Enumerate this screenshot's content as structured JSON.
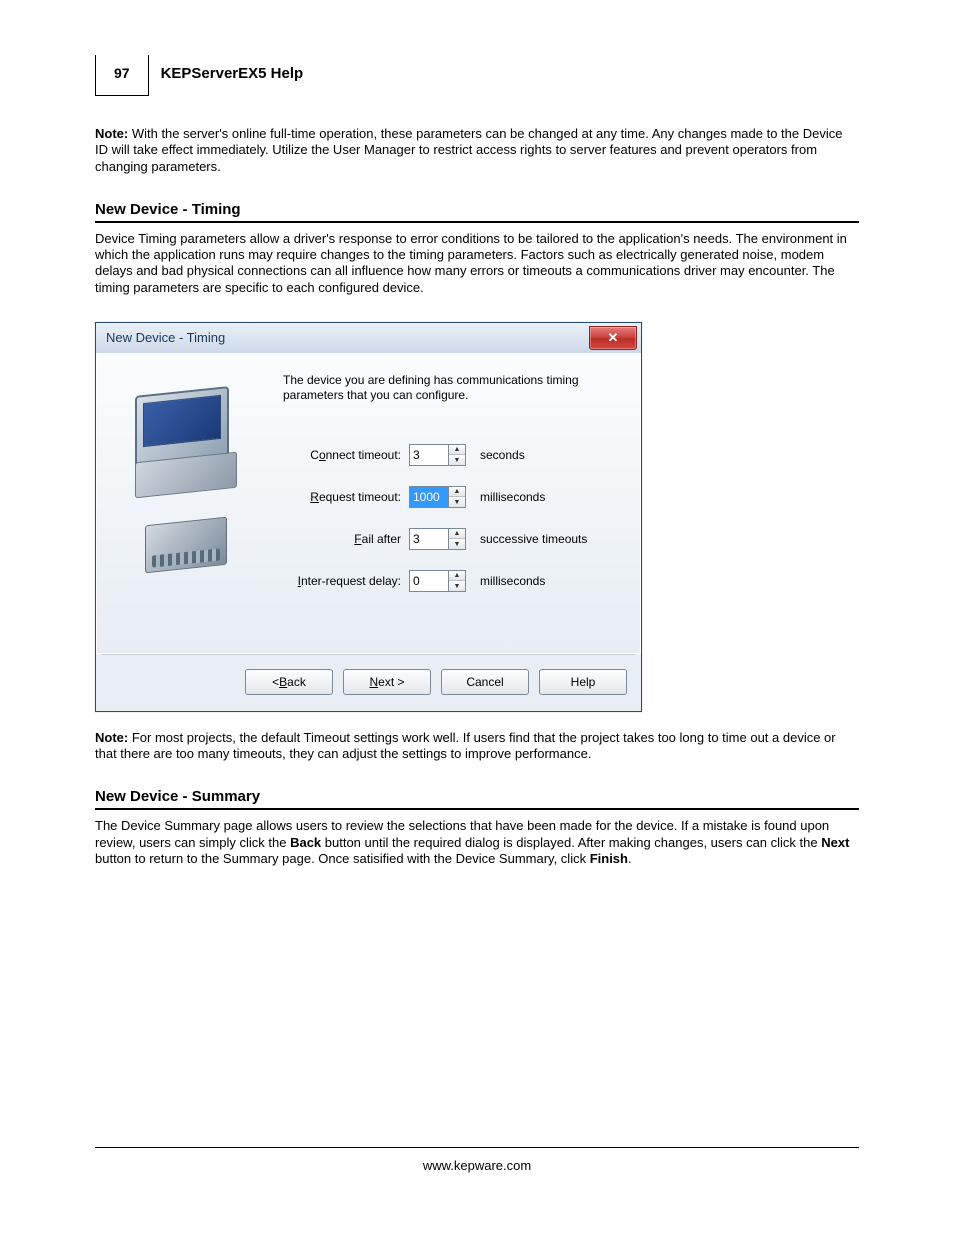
{
  "header": {
    "page_number": "97",
    "doc_title": "KEPServerEX5 Help"
  },
  "note1_label": "Note:",
  "note1_text": " With the server's online full-time operation, these parameters can be changed at any time. Any changes made to the Device ID will take effect immediately. Utilize the User Manager to restrict access rights to server features and prevent operators from changing parameters.",
  "section1": {
    "title": "New Device - Timing",
    "text": "Device Timing parameters allow a driver's response to error conditions to be tailored to the application's needs. The environment in which the application runs may require changes to the timing parameters. Factors such as electrically generated noise, modem delays and bad physical connections can all influence how many errors or timeouts a communications driver may encounter. The timing parameters are specific to each configured device."
  },
  "dialog": {
    "title": "New Device - Timing",
    "intro": "The device you are defining has communications timing parameters that you can configure.",
    "fields": {
      "connect": {
        "label_pre": "C",
        "label_ul": "o",
        "label_post": "nnect timeout:",
        "value": "3",
        "unit": "seconds"
      },
      "request": {
        "label_pre": "",
        "label_ul": "R",
        "label_post": "equest timeout:",
        "value": "1000",
        "unit": "milliseconds",
        "selected": true
      },
      "fail": {
        "label_pre": "",
        "label_ul": "F",
        "label_post": "ail after",
        "value": "3",
        "unit": "successive timeouts"
      },
      "inter": {
        "label_pre": "",
        "label_ul": "I",
        "label_post": "nter-request delay:",
        "value": "0",
        "unit": "milliseconds"
      }
    },
    "buttons": {
      "back_lt": "< ",
      "back_ul": "B",
      "back_post": "ack",
      "next_ul": "N",
      "next_post": "ext >",
      "cancel": "Cancel",
      "help": "Help"
    }
  },
  "note2_label": "Note:",
  "note2_text": " For most projects, the default Timeout settings work well. If users find that the project takes too long to time out a device or that there are too many timeouts, they can adjust the settings to improve performance.",
  "section2": {
    "title": "New Device - Summary",
    "pre": "The Device Summary page allows users to review the selections that have been made for the device. If a mistake is found upon review, users can simply click the ",
    "b1": "Back",
    "mid1": " button until the required dialog is displayed. After making changes, users can click the ",
    "b2": "Next",
    "mid2": " button to return to the Summary page. Once satisified with the Device Summary, click ",
    "b3": "Finish",
    "post": "."
  },
  "footer_url": "www.kepware.com"
}
